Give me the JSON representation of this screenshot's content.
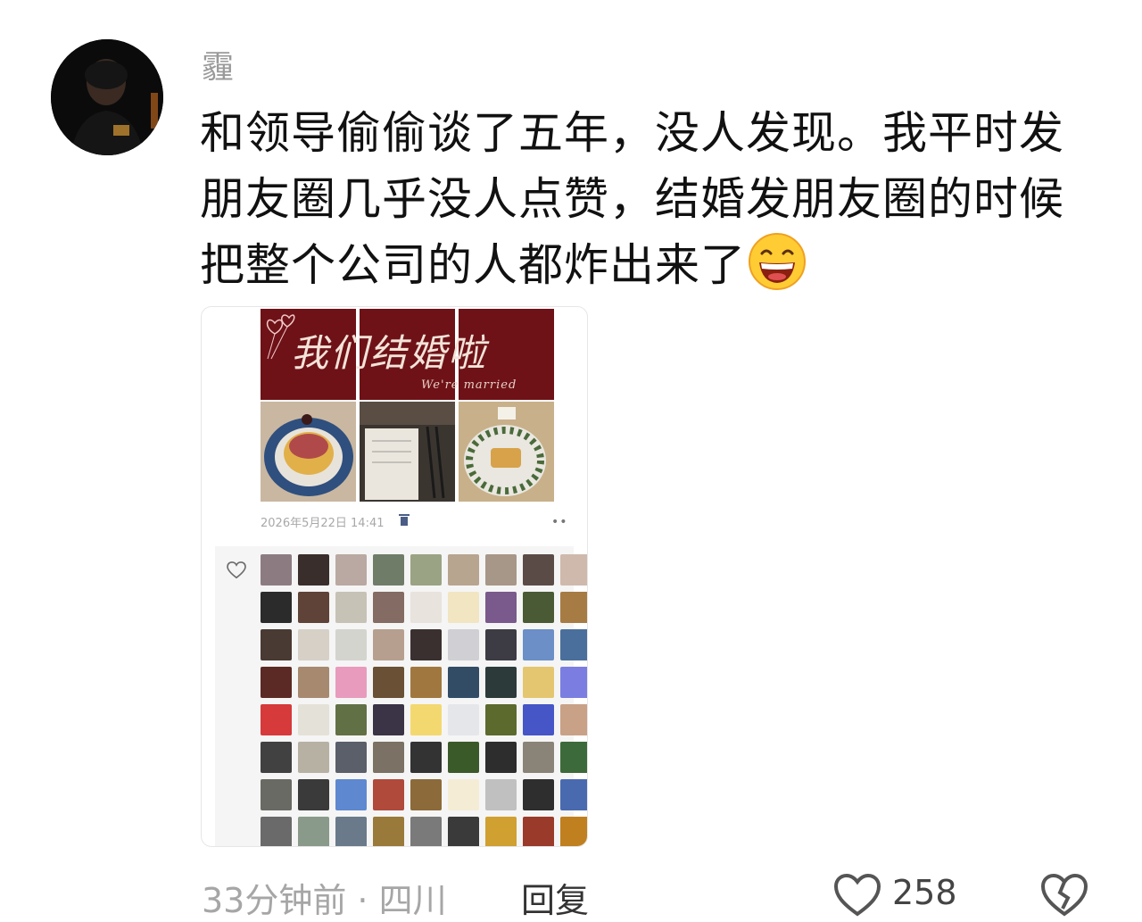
{
  "user": {
    "name": "霾"
  },
  "comment": {
    "lines": [
      "和领导偷偷谈了五年，没人发现。我平时发",
      "朋友圈几乎没人点赞，结婚发朋友圈的时候",
      "把整个公司的人都炸出来了"
    ],
    "emoji": "grinning-face-emoji"
  },
  "screenshot": {
    "banner_title": "我们结婚啦",
    "banner_subtitle": "We're married",
    "timestamp": "2026年5月22日 14:41",
    "more": "••",
    "photos": [
      "cake-photo",
      "table-setting-photo",
      "flower-dish-photo"
    ],
    "liker_avatar_colors": [
      "#8c7c82",
      "#3a2e2c",
      "#b9a9a2",
      "#6f7d68",
      "#9aa383",
      "#b8a58f",
      "#a79788",
      "#5b4b47",
      "#cfb9ad",
      "#2b2b2b",
      "#5f4238",
      "#c7c2b6",
      "#846b63",
      "#e8e3dc",
      "#f1e5c2",
      "#7a5a8c",
      "#4a5a34",
      "#a77b44",
      "#4a3a34",
      "#d6d0c7",
      "#d3d4cd",
      "#b79f8f",
      "#3b3030",
      "#cfcfd4",
      "#3d3c44",
      "#6b8fc6",
      "#4a6f9c",
      "#5c2a24",
      "#a6896f",
      "#e89bbd",
      "#6a5034",
      "#a0783f",
      "#324c66",
      "#2c3a3a",
      "#e3c66f",
      "#7b7ee0",
      "#d63a3a",
      "#e4e1d8",
      "#627046",
      "#3a3446",
      "#f3d870",
      "#e5e6ea",
      "#5c6a2e",
      "#4656c6",
      "#c9a187",
      "#414141",
      "#b7b1a4",
      "#5a5f6a",
      "#7b7164",
      "#333333",
      "#3b5a2a",
      "#2d2d2d",
      "#8a8378",
      "#3d6a3a",
      "#6a6a64",
      "#3a3a3a",
      "#5e88d0",
      "#b04a3a",
      "#8c6a3a",
      "#f4ecd4",
      "#c0c0c0",
      "#2e2e2e",
      "#4a6ab0",
      "#6a6a6a",
      "#8a9a8a",
      "#6a7a8a",
      "#9a7a3a",
      "#7a7a7a",
      "#3a3a3a",
      "#d0a030",
      "#9a3a2a",
      "#c08020"
    ]
  },
  "footer": {
    "time_location": "33分钟前 · 四川",
    "reply_label": "回复",
    "like_count": "258"
  }
}
